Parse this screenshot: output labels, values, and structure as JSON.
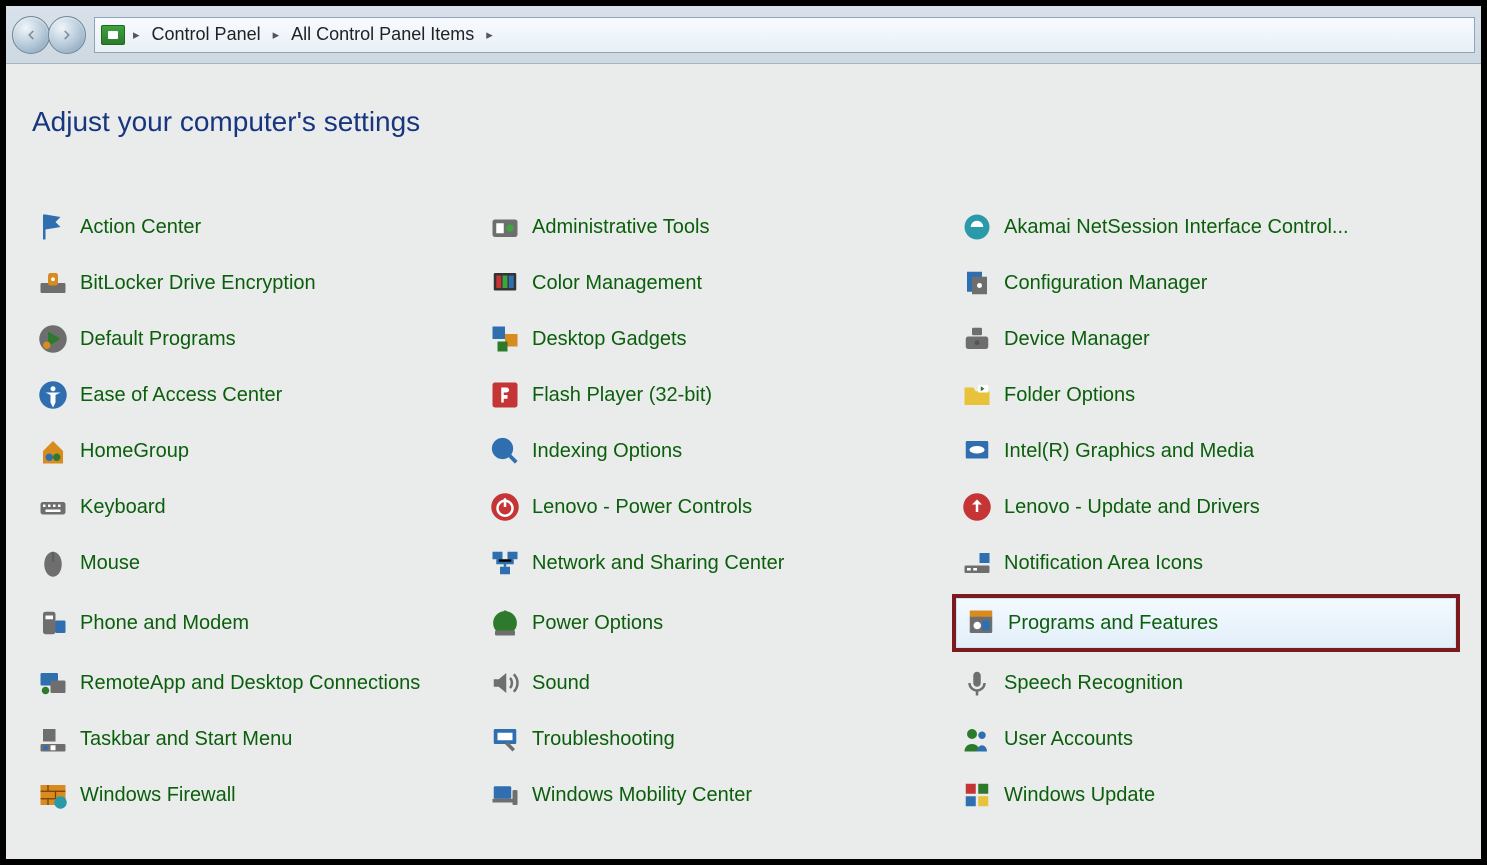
{
  "breadcrumb": {
    "item1": "Control Panel",
    "item2": "All Control Panel Items"
  },
  "heading": "Adjust your computer's settings",
  "items": {
    "col1": [
      {
        "label": "Action Center",
        "icon": "flag-icon"
      },
      {
        "label": "BitLocker Drive Encryption",
        "icon": "lock-drive-icon"
      },
      {
        "label": "Default Programs",
        "icon": "default-programs-icon"
      },
      {
        "label": "Ease of Access Center",
        "icon": "ease-access-icon"
      },
      {
        "label": "HomeGroup",
        "icon": "homegroup-icon"
      },
      {
        "label": "Keyboard",
        "icon": "keyboard-icon"
      },
      {
        "label": "Mouse",
        "icon": "mouse-icon"
      },
      {
        "label": "Phone and Modem",
        "icon": "phone-icon"
      },
      {
        "label": "RemoteApp and Desktop Connections",
        "icon": "remoteapp-icon"
      },
      {
        "label": "Taskbar and Start Menu",
        "icon": "taskbar-icon"
      },
      {
        "label": "Windows Firewall",
        "icon": "firewall-icon"
      }
    ],
    "col2": [
      {
        "label": "Administrative Tools",
        "icon": "admin-tools-icon"
      },
      {
        "label": "Color Management",
        "icon": "color-mgmt-icon"
      },
      {
        "label": "Desktop Gadgets",
        "icon": "gadgets-icon"
      },
      {
        "label": "Flash Player (32-bit)",
        "icon": "flash-icon"
      },
      {
        "label": "Indexing Options",
        "icon": "indexing-icon"
      },
      {
        "label": "Lenovo - Power Controls",
        "icon": "lenovo-power-icon"
      },
      {
        "label": "Network and Sharing Center",
        "icon": "network-icon"
      },
      {
        "label": "Power Options",
        "icon": "power-icon"
      },
      {
        "label": "Sound",
        "icon": "sound-icon"
      },
      {
        "label": "Troubleshooting",
        "icon": "troubleshoot-icon"
      },
      {
        "label": "Windows Mobility Center",
        "icon": "mobility-icon"
      }
    ],
    "col3": [
      {
        "label": "Akamai NetSession Interface Control...",
        "icon": "akamai-icon"
      },
      {
        "label": "Configuration Manager",
        "icon": "config-mgr-icon"
      },
      {
        "label": "Device Manager",
        "icon": "device-mgr-icon"
      },
      {
        "label": "Folder Options",
        "icon": "folder-icon"
      },
      {
        "label": "Intel(R) Graphics and Media",
        "icon": "intel-icon"
      },
      {
        "label": "Lenovo - Update and Drivers",
        "icon": "lenovo-update-icon"
      },
      {
        "label": "Notification Area Icons",
        "icon": "notification-icon"
      },
      {
        "label": "Programs and Features",
        "icon": "programs-icon",
        "highlight": true
      },
      {
        "label": "Speech Recognition",
        "icon": "speech-icon"
      },
      {
        "label": "User Accounts",
        "icon": "users-icon"
      },
      {
        "label": "Windows Update",
        "icon": "update-icon"
      }
    ]
  }
}
